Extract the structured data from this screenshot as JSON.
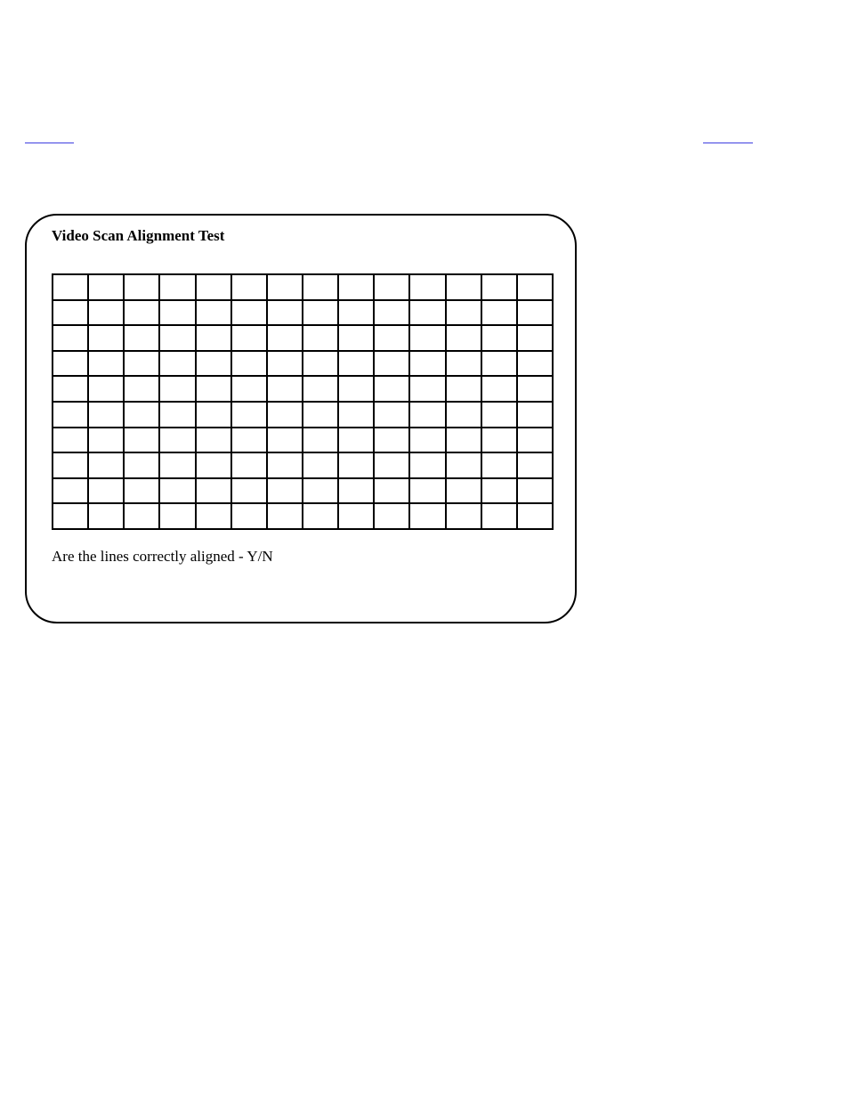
{
  "links": {
    "top_left_visible_text": "",
    "top_right_visible_text": ""
  },
  "panel": {
    "title": "Video Scan Alignment Test",
    "question": "Are the lines correctly aligned - Y/N",
    "grid": {
      "rows": 10,
      "cols": 14
    }
  }
}
